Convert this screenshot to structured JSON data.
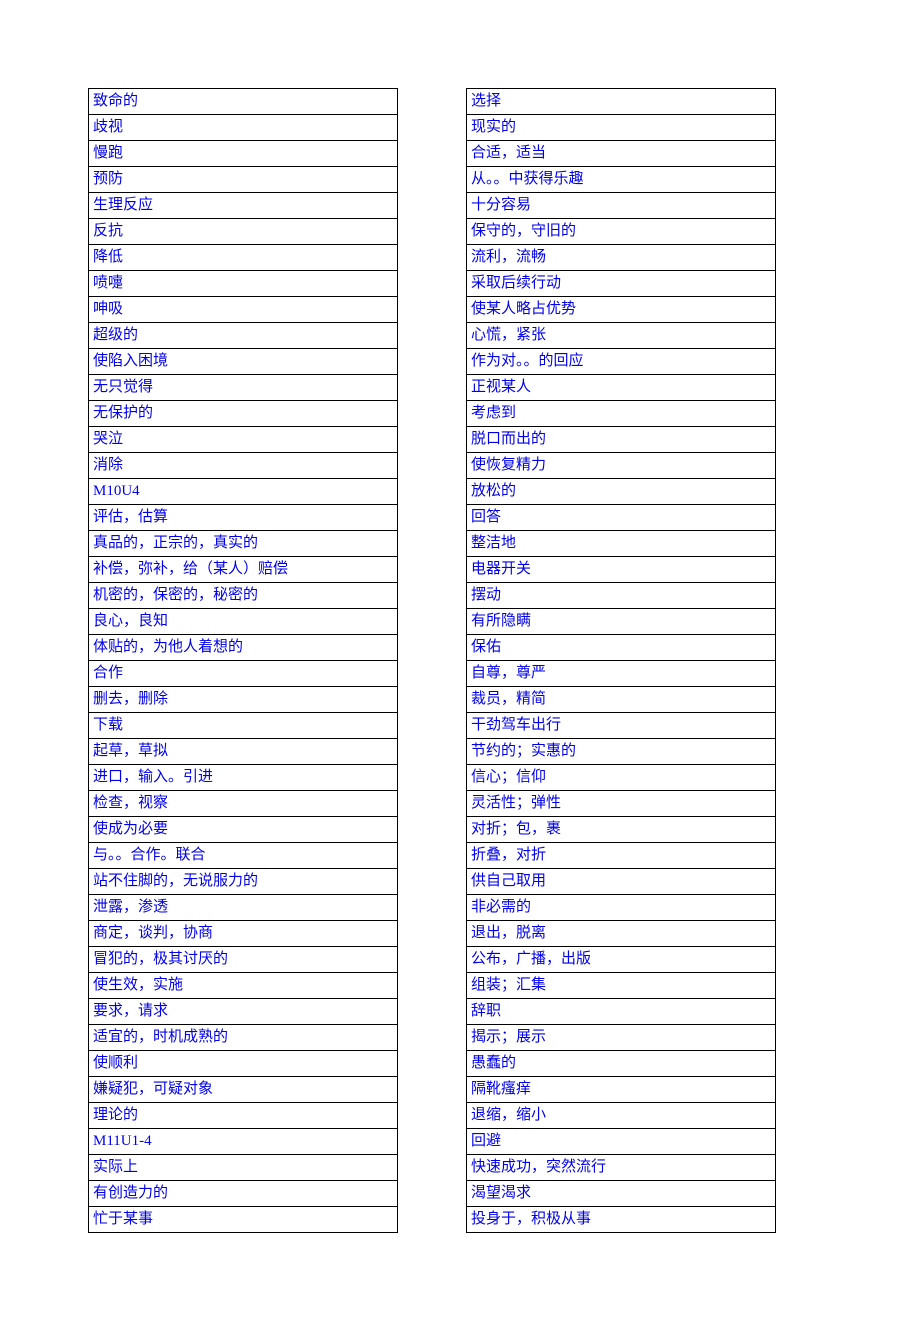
{
  "columns": [
    {
      "items": [
        "致命的",
        "歧视",
        "慢跑",
        "预防",
        "生理反应",
        "反抗",
        "降低",
        "喷嚏",
        "呻吸",
        "超级的",
        "使陷入困境",
        "无只觉得",
        "无保护的",
        "哭泣",
        "消除",
        "M10U4",
        "评估，估算",
        "真品的，正宗的，真实的",
        "补偿，弥补，给（某人）赔偿",
        "机密的，保密的，秘密的",
        "良心，良知",
        "体贴的，为他人着想的",
        "合作",
        "删去，删除",
        "下载",
        "起草，草拟",
        "进口，输入。引进",
        "检查，视察",
        "使成为必要",
        "与。。合作。联合",
        "站不住脚的，无说服力的",
        "泄露，渗透",
        "商定，谈判，协商",
        "冒犯的，极其讨厌的",
        "使生效，实施",
        "要求，请求",
        "适宜的，时机成熟的",
        "使顺利",
        "嫌疑犯，可疑对象",
        "理论的",
        "M11U1-4",
        "实际上",
        "有创造力的",
        "忙于某事"
      ]
    },
    {
      "items": [
        "选择",
        "现实的",
        "合适，适当",
        "从。。中获得乐趣",
        "十分容易",
        "保守的，守旧的",
        "流利，流畅",
        "采取后续行动",
        "使某人略占优势",
        "心慌，紧张",
        "作为对。。的回应",
        "正视某人",
        "考虑到",
        "脱口而出的",
        "使恢复精力",
        "放松的",
        "回答",
        "整洁地",
        "电器开关",
        "摆动",
        "有所隐瞒",
        "保佑",
        "自尊，尊严",
        "裁员，精简",
        "干劲驾车出行",
        "节约的；实惠的",
        "信心；信仰",
        "灵活性；弹性",
        "对折；包，裹",
        "折叠，对折",
        "供自己取用",
        "非必需的",
        "退出，脱离",
        "公布，广播，出版",
        "组装；汇集",
        "辞职",
        "揭示；展示",
        "愚蠢的",
        "隔靴瘙痒",
        "退缩，缩小",
        "回避",
        "快速成功，突然流行",
        "渴望渴求",
        "投身于，积极从事"
      ]
    }
  ]
}
